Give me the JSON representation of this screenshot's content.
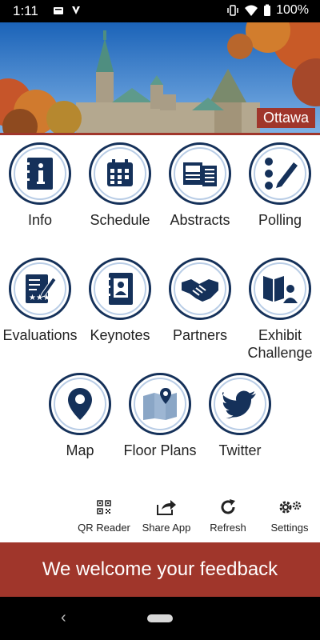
{
  "status_bar": {
    "time": "1:11",
    "battery": "100%",
    "icons": [
      "notification-icon",
      "app-icon",
      "vibrate-icon",
      "wifi-icon",
      "battery-icon"
    ]
  },
  "hero": {
    "city": "Ottawa"
  },
  "grid": [
    {
      "label": "Info",
      "icon": "info-icon"
    },
    {
      "label": "Schedule",
      "icon": "calendar-icon"
    },
    {
      "label": "Abstracts",
      "icon": "abstracts-icon"
    },
    {
      "label": "Polling",
      "icon": "polling-icon"
    },
    {
      "label": "Evaluations",
      "icon": "evaluations-icon"
    },
    {
      "label": "Keynotes",
      "icon": "keynotes-icon"
    },
    {
      "label": "Partners",
      "icon": "handshake-icon"
    },
    {
      "label_line1": "Exhibit",
      "label_line2": "Challenge",
      "icon": "exhibit-icon"
    },
    {
      "label": "Map",
      "icon": "map-pin-icon"
    },
    {
      "label": "Floor Plans",
      "icon": "floor-plans-icon"
    },
    {
      "label": "Twitter",
      "icon": "twitter-icon"
    }
  ],
  "toolbar": {
    "qr_reader": "QR Reader",
    "share_app": "Share App",
    "refresh": "Refresh",
    "settings": "Settings"
  },
  "feedback": {
    "text": "We welcome your feedback"
  },
  "colors": {
    "accent": "#a0362b",
    "icon_navy": "#15315a",
    "ring_light": "#b9cde6"
  }
}
